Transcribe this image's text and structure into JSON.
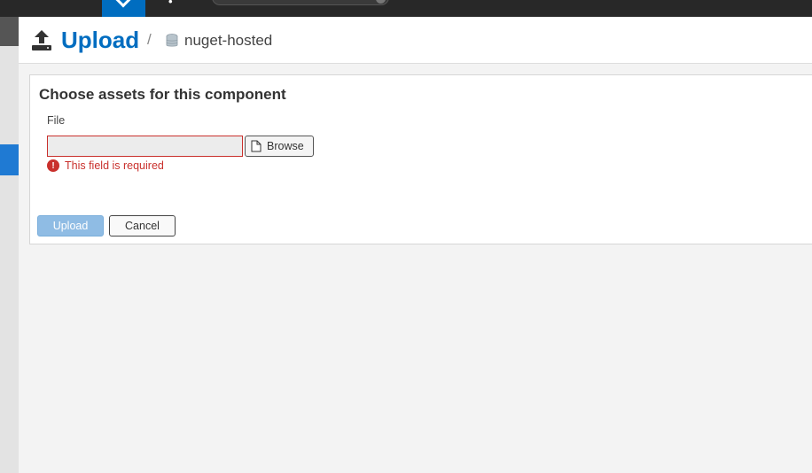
{
  "header": {
    "title": "Upload",
    "separator": "/",
    "repository": "nuget-hosted"
  },
  "form": {
    "panel_title": "Choose assets for this component",
    "file_label": "File",
    "file_value": "",
    "browse_label": "Browse",
    "error_icon": "!",
    "error_message": "This field is required",
    "upload_label": "Upload",
    "cancel_label": "Cancel"
  },
  "colors": {
    "brand_blue": "#006dc0",
    "error_red": "#c9302c",
    "disabled_button": "#8fbce4"
  },
  "icons": {
    "title_icon": "upload-icon",
    "repository_icon": "database-icon",
    "browse_icon": "file-icon",
    "error_icon": "exclamation-circle-icon"
  }
}
